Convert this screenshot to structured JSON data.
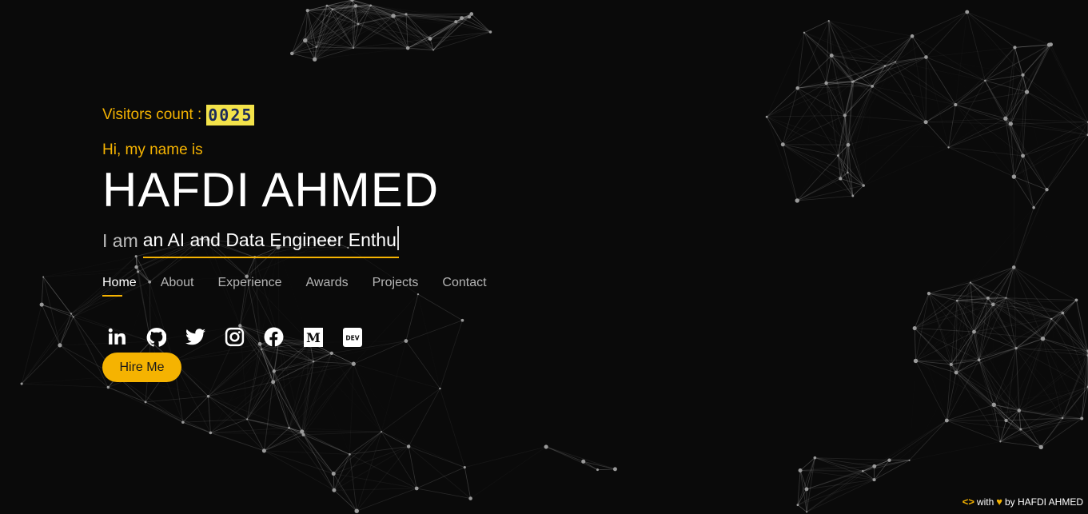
{
  "visitors": {
    "label": "Visitors count :",
    "count": "0025"
  },
  "intro": {
    "greeting": "Hi, my name is",
    "name": "HAFDI AHMED",
    "role_prefix": "I am",
    "role_typed": "an AI and Data Engineer Enthu"
  },
  "nav": {
    "items": [
      {
        "label": "Home",
        "active": true
      },
      {
        "label": "About"
      },
      {
        "label": "Experience"
      },
      {
        "label": "Awards"
      },
      {
        "label": "Projects"
      },
      {
        "label": "Contact"
      }
    ]
  },
  "socials": [
    {
      "icon": "linkedin-icon"
    },
    {
      "icon": "github-icon"
    },
    {
      "icon": "twitter-icon"
    },
    {
      "icon": "instagram-icon"
    },
    {
      "icon": "facebook-icon"
    },
    {
      "icon": "medium-icon",
      "glyph": "M"
    },
    {
      "icon": "dev-icon",
      "glyph": "DEV"
    }
  ],
  "hire_button": "Hire Me",
  "footer": {
    "code_glyph": "<>",
    "with": "with",
    "by": "by HAFDI AHMED"
  },
  "colors": {
    "background": "#0a0a0a",
    "accent": "#f5b301",
    "counter_bg": "#f3e34a"
  }
}
